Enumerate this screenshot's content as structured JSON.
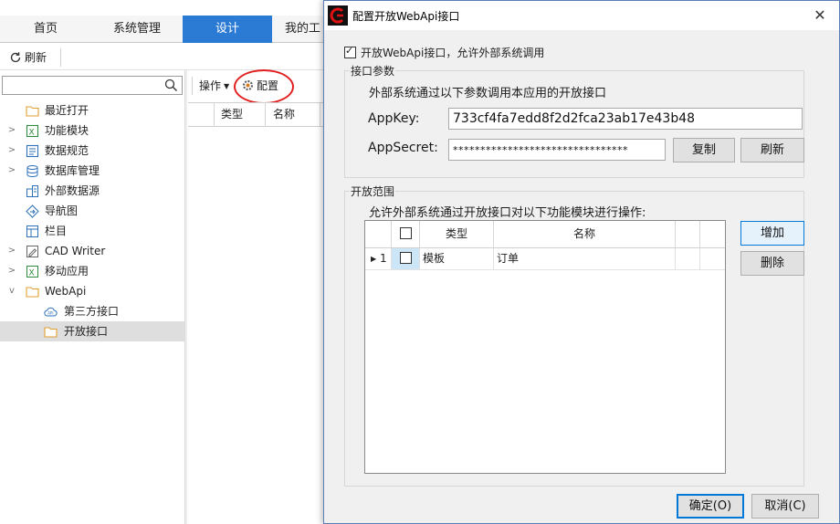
{
  "main": {
    "tabs": [
      {
        "label": "首页"
      },
      {
        "label": "系统管理"
      },
      {
        "label": "设计"
      },
      {
        "label": "我的工"
      }
    ],
    "toolbar": {
      "refresh_label": "刷新"
    },
    "search": {
      "value": "",
      "placeholder": ""
    },
    "tree": [
      {
        "label": "最近打开",
        "icon": "folder-icon"
      },
      {
        "label": "功能模块",
        "icon": "excel-module-icon"
      },
      {
        "label": "数据规范",
        "icon": "data-spec-icon"
      },
      {
        "label": "数据库管理",
        "icon": "database-icon"
      },
      {
        "label": "外部数据源",
        "icon": "external-datasource-icon"
      },
      {
        "label": "导航图",
        "icon": "navigation-map-icon"
      },
      {
        "label": "栏目",
        "icon": "column-layout-icon"
      },
      {
        "label": "CAD Writer",
        "icon": "cad-writer-icon"
      },
      {
        "label": "移动应用",
        "icon": "mobile-app-icon"
      },
      {
        "label": "WebApi",
        "icon": "folder-icon"
      },
      {
        "label": "第三方接口",
        "icon": "api-cloud-icon"
      },
      {
        "label": "开放接口",
        "icon": "folder-icon"
      }
    ],
    "ops": {
      "operate_label": "操作",
      "config_label": "配置"
    },
    "grid": {
      "columns": [
        "类型",
        "名称"
      ]
    }
  },
  "dialog": {
    "title": "配置开放WebApi接口",
    "close_glyph": "✕",
    "enable": {
      "checked": true,
      "label": "开放WebApi接口，允许外部系统调用"
    },
    "params": {
      "legend": "接口参数",
      "description": "外部系统通过以下参数调用本应用的开放接口",
      "appkey_label": "AppKey:",
      "appkey_value": "733cf4fa7edd8f2d2fca23ab17e43b48",
      "appsecret_label": "AppSecret:",
      "appsecret_value": "********************************",
      "copy_label": "复制",
      "refresh_label": "刷新"
    },
    "scope": {
      "legend": "开放范围",
      "description": "允许外部系统通过开放接口对以下功能模块进行操作:",
      "columns": [
        "类型",
        "名称"
      ],
      "rows": [
        {
          "index": "1",
          "checked": false,
          "type": "模板",
          "name": "订单"
        }
      ],
      "add_label": "增加",
      "delete_label": "删除"
    },
    "footer": {
      "ok_label": "确定(O)",
      "cancel_label": "取消(C)"
    }
  },
  "colors": {
    "accent": "#2b7ad4",
    "highlight": "#e02020",
    "dialog_border": "#5a7fb5"
  }
}
